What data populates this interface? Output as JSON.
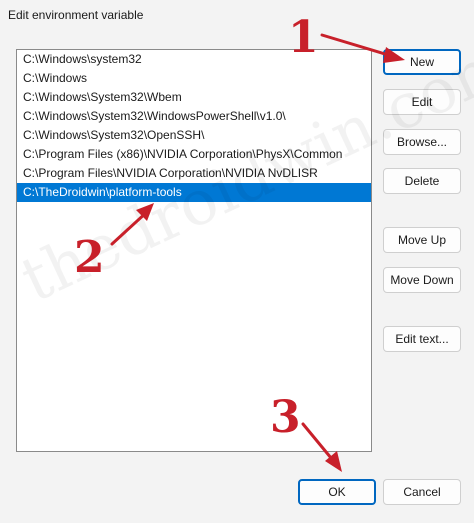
{
  "window": {
    "title": "Edit environment variable"
  },
  "paths": [
    "C:\\Windows\\system32",
    "C:\\Windows",
    "C:\\Windows\\System32\\Wbem",
    "C:\\Windows\\System32\\WindowsPowerShell\\v1.0\\",
    "C:\\Windows\\System32\\OpenSSH\\",
    "C:\\Program Files (x86)\\NVIDIA Corporation\\PhysX\\Common",
    "C:\\Program Files\\NVIDIA Corporation\\NVIDIA NvDLISR",
    "C:\\TheDroidwin\\platform-tools"
  ],
  "selected_index": 7,
  "buttons": {
    "new": "New",
    "edit": "Edit",
    "browse": "Browse...",
    "delete": "Delete",
    "move_up": "Move Up",
    "move_down": "Move Down",
    "edit_text": "Edit text...",
    "ok": "OK",
    "cancel": "Cancel"
  },
  "watermark": "thedroidwin.com",
  "annotations": {
    "one": "1",
    "two": "2",
    "three": "3"
  },
  "colors": {
    "accent": "#0078d4",
    "annotation": "#c8202a"
  }
}
